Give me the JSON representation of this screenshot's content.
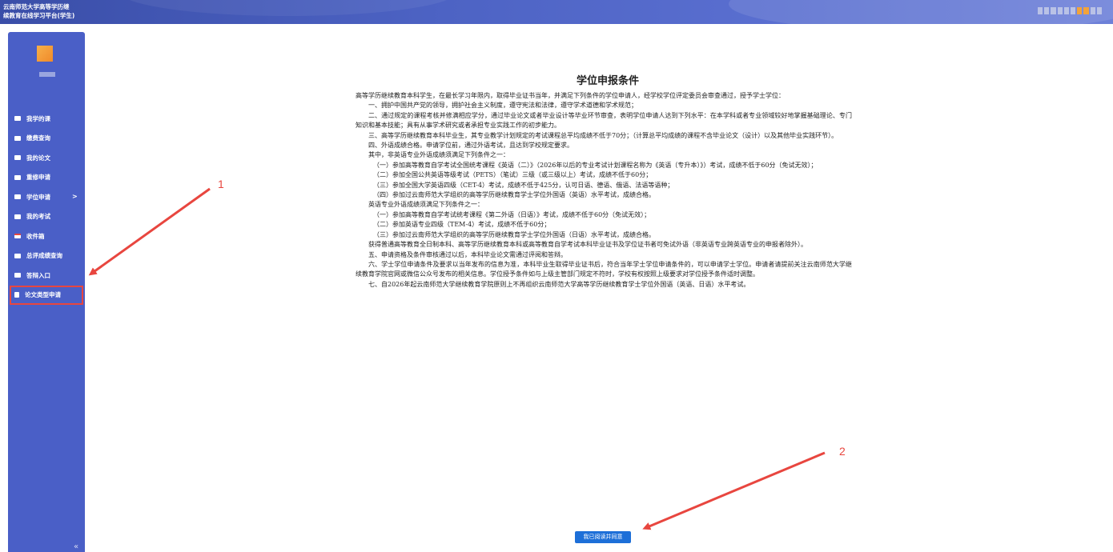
{
  "header": {
    "brand_line1": "云南师范大学高等学历继",
    "brand_line2": "续教育在线学习平台(学生)"
  },
  "sidebar": {
    "items": [
      {
        "label": "我学的课",
        "icon": "briefcase-icon"
      },
      {
        "label": "缴费查询",
        "icon": "briefcase-icon"
      },
      {
        "label": "我的论文",
        "icon": "briefcase-icon"
      },
      {
        "label": "重修申请",
        "icon": "briefcase-icon"
      },
      {
        "label": "学位申请",
        "icon": "briefcase-icon",
        "arrow": ">"
      },
      {
        "label": "我的考试",
        "icon": "briefcase-icon"
      },
      {
        "label": "收件箱",
        "icon": "inbox-icon"
      },
      {
        "label": "总评成绩查询",
        "icon": "briefcase-icon"
      },
      {
        "label": "答辩入口",
        "icon": "users-icon"
      },
      {
        "label": "论文类型申请",
        "icon": "document-icon",
        "active": true
      }
    ],
    "collapse_label": "«"
  },
  "main": {
    "title": "学位申报条件",
    "paragraphs": [
      "高等学历继续教育本科学生，在最长学习年限内，取得毕业证书当年，并满足下列条件的学位申请人，经学校学位评定委员会审查通过，授予学士学位：",
      "一、拥护中国共产党的领导，拥护社会主义制度，遵守宪法和法律，遵守学术道德和学术规范；",
      "二、通过规定的课程考核并修满相应学分，通过毕业论文或者毕业设计等毕业环节审查，表明学位申请人达到下列水平：在本学科或者专业领域较好地掌握基础理论、专门知识和基本技能；具有从事学术研究或者承担专业实践工作的初步能力。",
      "三、高等学历继续教育本科毕业生，其专业教学计划规定的考试课程总平均成绩不低于70分；（计算总平均成绩的课程不含毕业论文（设计）以及其他毕业实践环节）。",
      "四、外语成绩合格。申请学位前，通过外语考试，且达到学校规定要求。",
      "其中，非英语专业外语成绩须满足下列条件之一：",
      "（一）参加高等教育自学考试全国统考课程《英语（二）》（2026年以后的专业考试计划课程名称为《英语（专升本）》）考试，成绩不低于60分（免试无效）；",
      "（二）参加全国公共英语等级考试（PETS）（笔试）三级（或三级以上）考试，成绩不低于60分；",
      "（三）参加全国大学英语四级（CET-4）考试，成绩不低于425分，认可日语、德语、俄语、法语等语种；",
      "（四）参加过云南师范大学组织的高等学历继续教育学士学位外国语（英语）水平考试，成绩合格。",
      "英语专业外语成绩须满足下列条件之一：",
      "（一）参加高等教育自学考试统考课程《第二外语（日语）》考试，成绩不低于60分（免试无效）；",
      "（二）参加英语专业四级（TEM-4）考试，成绩不低于60分；",
      "（三）参加过云南师范大学组织的高等学历继续教育学士学位外国语（日语）水平考试，成绩合格。",
      "获得普通高等教育全日制本科、高等学历继续教育本科或高等教育自学考试本科毕业证书及学位证书者可免试外语（非英语专业跨英语专业的申报者除外）。",
      "五、申请资格及条件审核通过以后，本科毕业论文需通过评阅和答辩。",
      "六、学士学位申请条件及要求以当年发布的信息为准，本科毕业生取得毕业证书后，符合当年学士学位申请条件的，可以申请学士学位。申请者请提前关注云南师范大学继续教育学院官网或微信公众号发布的相关信息。学位授予条件如与上级主管部门规定不符时，学校有权按照上级要求对学位授予条件适时调整。",
      "七、自2026年起云南师范大学继续教育学院原则上不再组织云南师范大学高等学历继续教育学士学位外国语（英语、日语）水平考试。"
    ],
    "agree_button": "我已阅读并同意"
  },
  "annotations": {
    "label1": "1",
    "label2": "2",
    "color": "#e8463f"
  }
}
